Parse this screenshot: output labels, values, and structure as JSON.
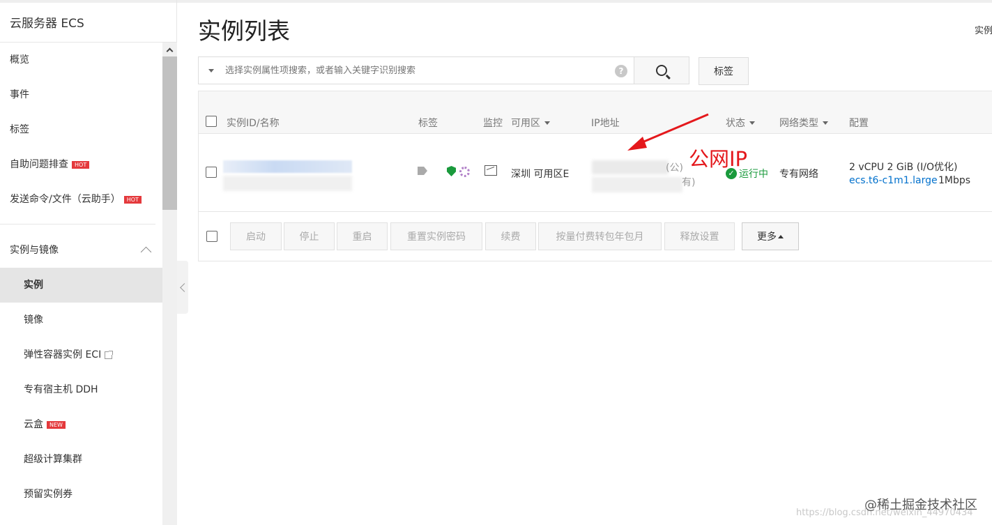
{
  "sidebar": {
    "title": "云服务器 ECS",
    "items": [
      {
        "label": "概览"
      },
      {
        "label": "事件"
      },
      {
        "label": "标签"
      },
      {
        "label": "自助问题排查",
        "badge": "HOT"
      },
      {
        "label": "发送命令/文件（云助手）",
        "badge": "HOT"
      }
    ],
    "group": {
      "label": "实例与镜像",
      "items": [
        {
          "label": "实例"
        },
        {
          "label": "镜像"
        },
        {
          "label": "弹性容器实例 ECI"
        },
        {
          "label": "专有宿主机 DDH"
        },
        {
          "label": "云盒",
          "badge": "NEW"
        },
        {
          "label": "超级计算集群"
        },
        {
          "label": "预留实例券"
        }
      ]
    }
  },
  "page": {
    "title": "实例列表",
    "top_right": "实例"
  },
  "search": {
    "placeholder": "选择实例属性项搜索，或者输入关键字识别搜索",
    "help": "?",
    "tag_button": "标签"
  },
  "table": {
    "headers": {
      "id_name": "实例ID/名称",
      "tags": "标签",
      "monitor": "监控",
      "zone": "可用区",
      "ip": "IP地址",
      "status": "状态",
      "network": "网络类型",
      "config": "配置"
    },
    "row": {
      "zone": "深圳 可用区E",
      "ip_public_suffix": "(公)",
      "ip_private_suffix": "有)",
      "status": "运行中",
      "network": "专有网络",
      "config_line1": "2 vCPU 2 GiB   (I/O优化)",
      "instance_type": "ecs.t6-c1m1.large",
      "bandwidth": "1Mbps"
    }
  },
  "actions": {
    "start": "启动",
    "stop": "停止",
    "restart": "重启",
    "reset_password": "重置实例密码",
    "renew": "续费",
    "convert_billing": "按量付费转包年包月",
    "release_settings": "释放设置",
    "more": "更多"
  },
  "annotation": {
    "text": "公网IP",
    "color": "#e4181c"
  },
  "watermark": {
    "main": "@稀土掘金技术社区",
    "url": "https://blog.csdn.net/weixin_44970434"
  },
  "colors": {
    "status_green": "#1a9a3c",
    "link_blue": "#0070cc",
    "badge_red": "#e4393c"
  }
}
